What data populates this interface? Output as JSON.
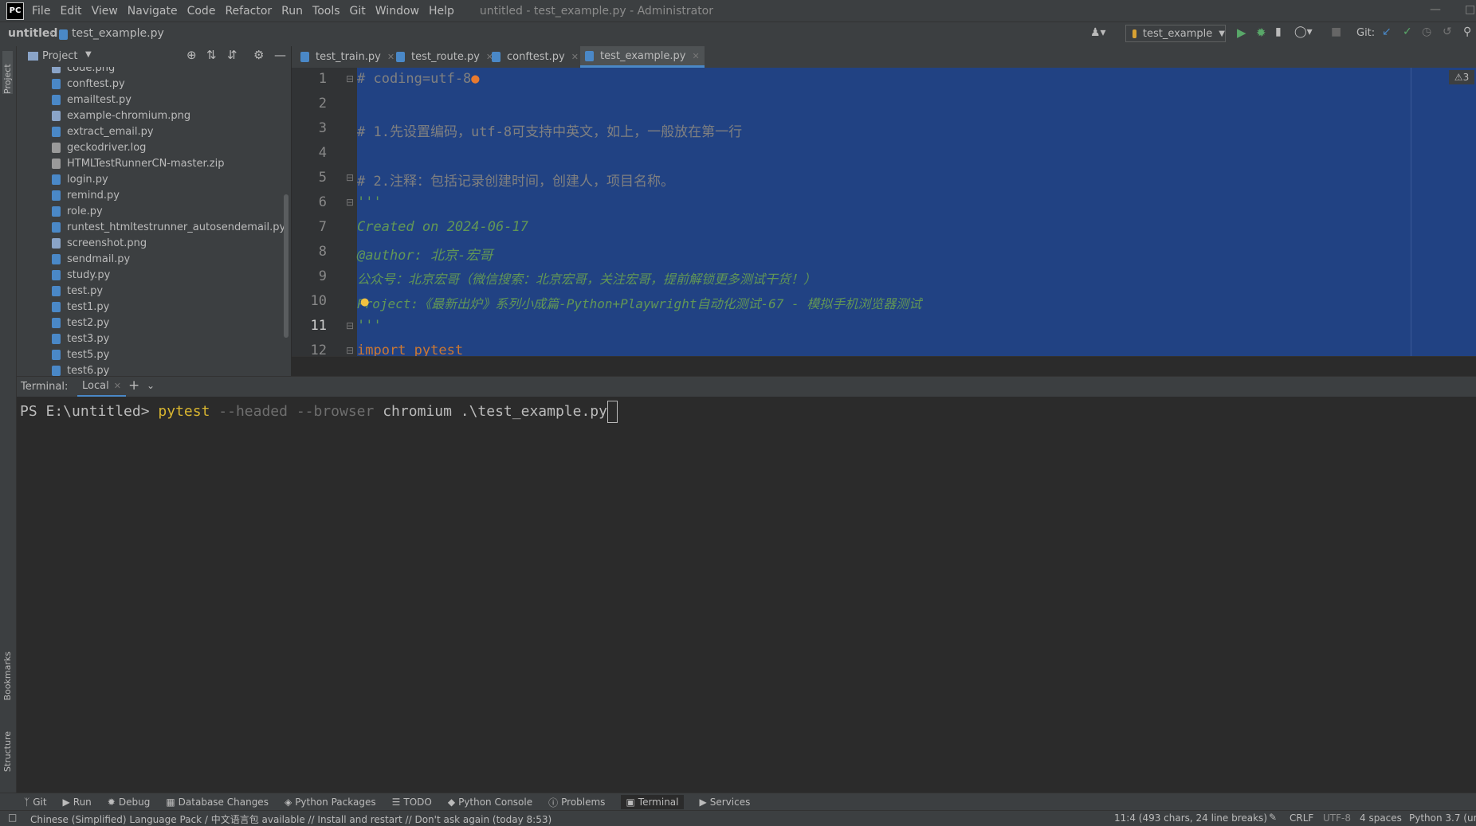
{
  "menu": {
    "logo": "PC",
    "items": [
      "File",
      "Edit",
      "View",
      "Navigate",
      "Code",
      "Refactor",
      "Run",
      "Tools",
      "Git",
      "Window",
      "Help"
    ],
    "window_title": "untitled - test_example.py - Administrator"
  },
  "nav": {
    "project": "untitled",
    "file": "test_example.py",
    "run_config": "test_example",
    "git_label": "Git:"
  },
  "left_stripe": {
    "project": "Project",
    "bookmarks": "Bookmarks",
    "structure": "Structure"
  },
  "project_panel": {
    "title": "Project",
    "files": [
      "code.png",
      "conftest.py",
      "emailtest.py",
      "example-chromium.png",
      "extract_email.py",
      "geckodriver.log",
      "HTMLTestRunnerCN-master.zip",
      "login.py",
      "remind.py",
      "role.py",
      "runtest_htmltestrunner_autosendemail.py",
      "screenshot.png",
      "sendmail.py",
      "study.py",
      "test.py",
      "test1.py",
      "test2.py",
      "test3.py",
      "test5.py",
      "test6.py"
    ]
  },
  "tabs": [
    {
      "label": "test_train.py"
    },
    {
      "label": "test_route.py"
    },
    {
      "label": "conftest.py"
    },
    {
      "label": "test_example.py",
      "active": true
    }
  ],
  "editor": {
    "warning_count": "3",
    "lines": [
      {
        "n": "1",
        "text": "# coding=utf-8",
        "kind": "comment"
      },
      {
        "n": "2",
        "text": "",
        "kind": "comment"
      },
      {
        "n": "3",
        "text": "# 1.先设置编码，utf-8可支持中英文，如上，一般放在第一行",
        "kind": "comment"
      },
      {
        "n": "4",
        "text": "",
        "kind": "comment"
      },
      {
        "n": "5",
        "text": "# 2.注释：包括记录创建时间，创建人，项目名称。",
        "kind": "comment"
      },
      {
        "n": "6",
        "text": "'''",
        "kind": "doc"
      },
      {
        "n": "7",
        "text": "Created on 2024-06-17",
        "kind": "doc"
      },
      {
        "n": "8",
        "text": "@author: 北京-宏哥",
        "kind": "doc"
      },
      {
        "n": "9",
        "text": "公众号：北京宏哥（微信搜索：北京宏哥，关注宏哥，提前解锁更多测试干货！）",
        "kind": "doc"
      },
      {
        "n": "10",
        "text": "Project:《最新出炉》系列小成篇-Python+Playwright自动化测试-67 - 模拟手机浏览器测试",
        "kind": "doc"
      },
      {
        "n": "11",
        "text": "'''",
        "kind": "doc"
      },
      {
        "n": "12",
        "text": "import pytest",
        "kind": "code"
      }
    ]
  },
  "terminal": {
    "label": "Terminal:",
    "tab": "Local",
    "prompt": "PS E:\\untitled>",
    "cmd": "pytest",
    "arg1": "--headed",
    "arg2": "--browser",
    "arg3": "chromium .\\test_example.py"
  },
  "tool_windows": [
    "Git",
    "Run",
    "Debug",
    "Database Changes",
    "Python Packages",
    "TODO",
    "Python Console",
    "Problems",
    "Terminal",
    "Services"
  ],
  "status": {
    "message": "Chinese (Simplified) Language Pack / 中文语言包 available // Install and restart // Don't ask again (today 8:53)",
    "position": "11:4 (493 chars, 24 line breaks)",
    "line_sep": "CRLF",
    "encoding": "UTF-8",
    "indent": "4 spaces",
    "interpreter": "Python 3.7 (un"
  },
  "colors": {
    "selection": "#214283",
    "accent": "#4a88c7",
    "run_green": "#59a869"
  }
}
